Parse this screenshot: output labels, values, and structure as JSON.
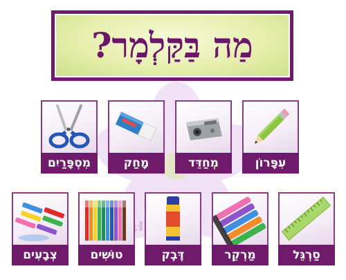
{
  "title": "מַה בַּקַּלְמָר?",
  "watermark": "שׁוּבְּך",
  "row1": [
    {
      "label": "עִפָּרוֹן",
      "icon": "pencil-icon"
    },
    {
      "label": "מְחַדֵּד",
      "icon": "sharpener-icon"
    },
    {
      "label": "מָחַק",
      "icon": "eraser-icon"
    },
    {
      "label": "מִסְפָּרַיִם",
      "icon": "scissors-icon"
    }
  ],
  "row2": [
    {
      "label": "סַרְגֵּל",
      "icon": "ruler-icon"
    },
    {
      "label": "מַרְקֵר",
      "icon": "markers-icon"
    },
    {
      "label": "דֶּבֶק",
      "icon": "glue-stick-icon"
    },
    {
      "label": "טוּשִׁים",
      "icon": "felt-pens-icon"
    },
    {
      "label": "צְבָעִים",
      "icon": "crayons-icon"
    }
  ],
  "colors": {
    "frame": "#6f1a6a",
    "title_text": "#6b1768",
    "title_bg": "#e6efad"
  }
}
